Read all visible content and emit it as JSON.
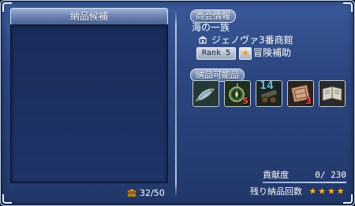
{
  "left_panel": {
    "title": "納品候補",
    "capacity": "32/50",
    "capacity_icon": "crate-icon"
  },
  "guild_info": {
    "header": "商会情報",
    "guild_name": "海の一族",
    "shop_icon": "shop-icon",
    "shop_name": "ジェノヴァ3番商館",
    "rank": "Rank 5",
    "rank_star": "★",
    "rank_title": "冒険補助"
  },
  "deliverables": {
    "header": "納品可能品",
    "items": [
      {
        "name": "fish-item-icon",
        "qty": ""
      },
      {
        "name": "compass-item-icon",
        "qty": "5"
      },
      {
        "name": "cannon-item-icon",
        "qty": "",
        "overlay": "14"
      },
      {
        "name": "map-item-icon",
        "qty": "3"
      },
      {
        "name": "book-item-icon",
        "qty": ""
      }
    ]
  },
  "contribution": {
    "label": "貢献度",
    "value": "0/",
    "max": "230"
  },
  "remaining": {
    "label": "残り納品回数",
    "stars": "★★★★"
  },
  "colors": {
    "window_bg": "#2c4680",
    "star": "#f0b030",
    "qty": "#ff5050"
  }
}
